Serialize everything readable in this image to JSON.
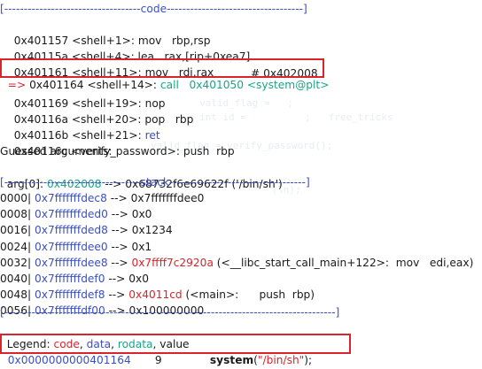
{
  "colors": {
    "separator": "#3a4fc4",
    "address": "#3a4fc4",
    "pointer": "#d8242a",
    "call": "#18a58c",
    "highlight_box": "#d8242a"
  },
  "code_section": {
    "header": "[-----------------------------------code-----------------------------------]",
    "lines": [
      {
        "addr": "0x401157",
        "sym": "<shell+1>:",
        "instr": " mov   rbp,rsp",
        "comment": ""
      },
      {
        "addr": "0x40115a",
        "sym": "<shell+4>:",
        "instr": " lea   rax,[rip+0xea7]",
        "comment": "# 0x402008"
      },
      {
        "addr": "0x401161",
        "sym": "<shell+11>:",
        "instr": " mov   rdi,rax",
        "comment": ""
      },
      {
        "arrow": "=> ",
        "addr": "0x401164",
        "sym": "<shell+14>:",
        "call": " call   0x401050 <system@plt>"
      },
      {
        "addr": "0x401169",
        "sym": "<shell+19>:",
        "instr": " nop"
      },
      {
        "addr": "0x40116a",
        "sym": "<shell+20>:",
        "instr": " pop   rbp"
      },
      {
        "addr": "0x40116b",
        "sym": "<shell+21>:",
        "ret": " ret"
      },
      {
        "addr": "0x40116c",
        "sym": "<verify_password>:",
        "instr": " push  rbp"
      }
    ]
  },
  "guessed": {
    "title": "Guessed arguments:",
    "arg_label": "arg[0]: ",
    "arg_addr": "0x402008",
    "arg_rest": " --> 0x68732f6e69622f ('/bin/sh')"
  },
  "stack_section": {
    "header": "[-----------------------------------stack-----------------------------------]",
    "rows": [
      {
        "off": "0000|",
        "addr": " 0x7fffffffdec8",
        "arrow": " --> ",
        "val": "0x7fffffffdee0",
        "val_color": "plain",
        "tail": ""
      },
      {
        "off": "0008|",
        "addr": " 0x7fffffffded0",
        "arrow": " --> ",
        "val": "0x0",
        "val_color": "plain",
        "tail": ""
      },
      {
        "off": "0016|",
        "addr": " 0x7fffffffded8",
        "arrow": " --> ",
        "val": "0x1234",
        "val_color": "plain",
        "tail": ""
      },
      {
        "off": "0024|",
        "addr": " 0x7fffffffdee0",
        "arrow": " --> ",
        "val": "0x1",
        "val_color": "plain",
        "tail": ""
      },
      {
        "off": "0032|",
        "addr": " 0x7fffffffdee8",
        "arrow": " --> ",
        "val": "0x7ffff7c2920a",
        "val_color": "red",
        "tail": " (<__libc_start_call_main+122>:  mov   edi,eax)"
      },
      {
        "off": "0040|",
        "addr": " 0x7fffffffdef0",
        "arrow": " --> ",
        "val": "0x0",
        "val_color": "plain",
        "tail": ""
      },
      {
        "off": "0048|",
        "addr": " 0x7fffffffdef8",
        "arrow": " --> ",
        "val": "0x4011cd",
        "val_color": "red",
        "tail": " (<main>:      push  rbp)"
      },
      {
        "off": "0056|",
        "addr": " 0x7fffffffdf00",
        "arrow": " --> ",
        "val": "0x100000000",
        "val_color": "plain",
        "tail": ""
      }
    ]
  },
  "footer_separator": "[-------------------------------------------------------------------------------------]",
  "legend": {
    "label": "Legend: ",
    "code": "code",
    "sep1": ", ",
    "data": "data",
    "sep2": ", ",
    "rodata": "rodata",
    "sep3": ", ",
    "value": "value"
  },
  "final_line": {
    "addr": "0x0000000000401164",
    "lineno": "       9",
    "func": "system",
    "open": "(",
    "str": "\"/bin/sh\"",
    "close": ");"
  }
}
